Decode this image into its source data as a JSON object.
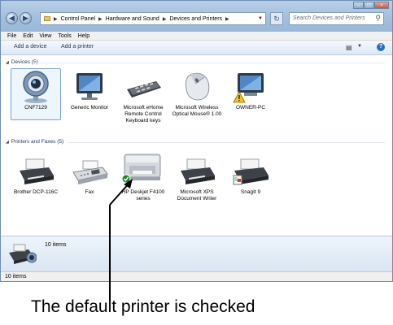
{
  "address": {
    "crumbs": [
      "Control Panel",
      "Hardware and Sound",
      "Devices and Printers"
    ],
    "search_placeholder": "Search Devices and Printers"
  },
  "menu": [
    "File",
    "Edit",
    "View",
    "Tools",
    "Help"
  ],
  "commands": {
    "add_device": "Add a device",
    "add_printer": "Add a printer"
  },
  "devices": {
    "header": "Devices (5)",
    "items": [
      {
        "label": "CNF7129",
        "icon": "webcam-icon",
        "selected": true
      },
      {
        "label": "Generic Monitor",
        "icon": "monitor-icon"
      },
      {
        "label": "Microsoft eHome Remote Control Keyboard keys",
        "icon": "keyboard-icon"
      },
      {
        "label": "Microsoft Wireless Optical Mouse® 1.00",
        "icon": "mouse-icon"
      },
      {
        "label": "OWNER-PC",
        "icon": "computer-warning-icon"
      }
    ]
  },
  "printers": {
    "header": "Printers and Faxes (5)",
    "items": [
      {
        "label": "Brother DCP-116C",
        "icon": "printer-icon"
      },
      {
        "label": "Fax",
        "icon": "fax-icon"
      },
      {
        "label": "HP Deskjet F4100 series",
        "icon": "default-printer-icon",
        "default": true
      },
      {
        "label": "Microsoft XPS Document Writer",
        "icon": "printer-icon"
      },
      {
        "label": "SnagIt 9",
        "icon": "snagit-printer-icon"
      }
    ]
  },
  "details_count": "10 items",
  "status_count": "10 items",
  "caption": "The default printer is checked"
}
